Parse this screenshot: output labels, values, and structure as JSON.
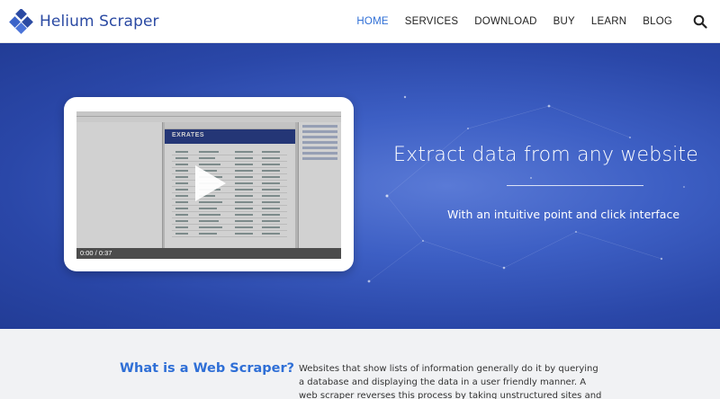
{
  "header": {
    "brand": "Helium Scraper",
    "nav": [
      {
        "label": "HOME",
        "active": true
      },
      {
        "label": "SERVICES",
        "active": false
      },
      {
        "label": "DOWNLOAD",
        "active": false
      },
      {
        "label": "BUY",
        "active": false
      },
      {
        "label": "LEARN",
        "active": false
      },
      {
        "label": "BLOG",
        "active": false
      }
    ],
    "search_icon": "search-icon"
  },
  "hero": {
    "title": "Extract data from any website",
    "subtitle": "With an intuitive point and click interface",
    "video": {
      "time": "0:00 / 0:37",
      "brand": "EXRATES",
      "play_icon": "play-icon"
    }
  },
  "section": {
    "heading": "What is a Web Scraper?",
    "body": "Websites that show lists of information generally do it by querying a database and displaying the data in a user friendly manner. A web scraper reverses this process by taking unstructured sites and turning them back into an organized database. This"
  },
  "colors": {
    "brand_blue": "#2b4aa3",
    "nav_active": "#2f6fd6",
    "hero_bg": "#3d5fc4",
    "section_bg": "#f1f2f4"
  }
}
